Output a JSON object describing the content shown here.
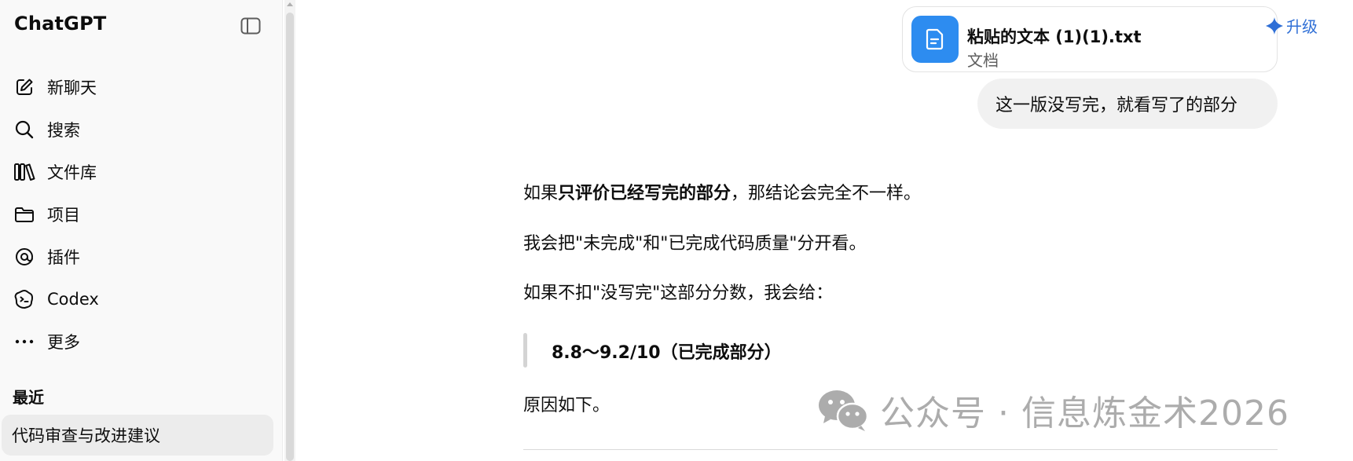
{
  "sidebar": {
    "brand": "ChatGPT",
    "toggle_icon": "sidebar-toggle-icon",
    "items": [
      {
        "label": "新聊天",
        "icon": "new-chat-icon"
      },
      {
        "label": "搜索",
        "icon": "search-icon"
      },
      {
        "label": "文件库",
        "icon": "library-icon"
      },
      {
        "label": "项目",
        "icon": "folder-icon"
      },
      {
        "label": "插件",
        "icon": "plugin-icon"
      },
      {
        "label": "Codex",
        "icon": "codex-icon"
      },
      {
        "label": "更多",
        "icon": "more-icon"
      }
    ],
    "recent_title": "最近",
    "recent_items": [
      "代码审查与改进建议"
    ]
  },
  "header": {
    "upgrade_label": "升级",
    "upgrade_color": "#2f6fd6"
  },
  "attachment": {
    "name": "粘贴的文本 (1)(1).txt",
    "type": "文档",
    "icon": "document-icon",
    "icon_color": "#2d8cf0"
  },
  "user_message": "这一版没写完，就看写了的部分",
  "assistant": {
    "p1_prefix": "如果",
    "p1_bold": "只评价已经写完的部分",
    "p1_suffix": "，那结论会完全不一样。",
    "p2": "我会把\"未完成\"和\"已完成代码质量\"分开看。",
    "p3": "如果不扣\"没写完\"这部分分数，我会给：",
    "quote": "8.8～9.2/10（已完成部分）",
    "p4": "原因如下。"
  },
  "watermark": {
    "icon": "wechat-icon",
    "text": "公众号 · 信息炼金术2026"
  }
}
